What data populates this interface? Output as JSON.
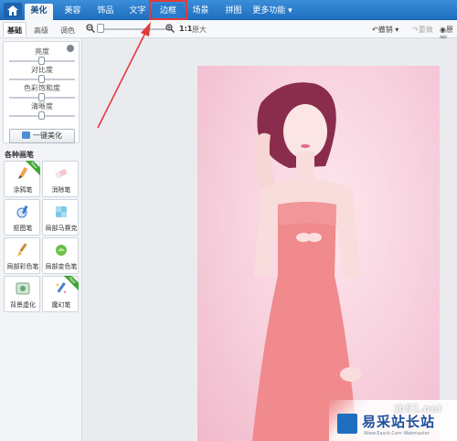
{
  "topnav": {
    "tabs": [
      {
        "label": "美化",
        "active": true
      },
      {
        "label": "美容"
      },
      {
        "label": "饰品"
      },
      {
        "label": "文字"
      },
      {
        "label": "边框",
        "highlighted": true
      },
      {
        "label": "场景"
      },
      {
        "label": "拼图"
      },
      {
        "label": "更多功能"
      }
    ]
  },
  "subbar": {
    "tabs": [
      "基础",
      "高级",
      "调色"
    ],
    "zoom_ratio": "1:1",
    "zoom_label": "原大",
    "undo": "撤销",
    "redo": "重做",
    "compare": "原图"
  },
  "adjust": {
    "sliders": [
      {
        "label": "亮度",
        "value": 0.5
      },
      {
        "label": "对比度",
        "value": 0.5
      },
      {
        "label": "色彩饱和度",
        "value": 0.5
      },
      {
        "label": "清晰度",
        "value": 0.5
      }
    ],
    "one_click_label": "一键美化"
  },
  "brushes": {
    "title": "各种画笔",
    "items": [
      {
        "label": "涂鸦笔",
        "icon": "doodle-pen-icon",
        "badge": "New"
      },
      {
        "label": "消除笔",
        "icon": "eraser-icon"
      },
      {
        "label": "抠图笔",
        "icon": "cutout-pen-icon"
      },
      {
        "label": "局部马赛克",
        "icon": "mosaic-icon"
      },
      {
        "label": "局部彩色笔",
        "icon": "color-brush-icon"
      },
      {
        "label": "局部变色笔",
        "icon": "recolor-brush-icon"
      },
      {
        "label": "背景虚化",
        "icon": "blur-background-icon"
      },
      {
        "label": "魔幻笔",
        "icon": "magic-pen-icon",
        "badge": "New"
      }
    ]
  },
  "watermark": {
    "url": "jb51.net",
    "site": "易采站长站",
    "sub": "Www.Easck.Com Webmaster"
  },
  "colors": {
    "nav_blue": "#1f6fc0",
    "annotation_red": "#e23a3a",
    "photo_pink": "#f7cfdc"
  }
}
